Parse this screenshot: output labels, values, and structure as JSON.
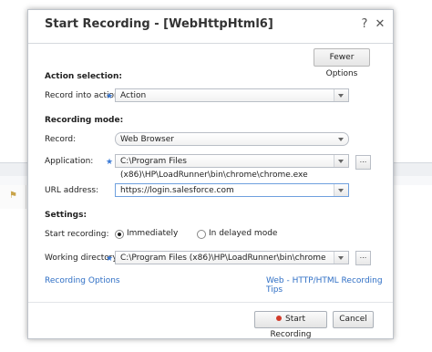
{
  "dialog": {
    "title": "Start Recording - [WebHttpHtml6]",
    "help": "?",
    "close": "✕",
    "fewer_options": "Fewer Options"
  },
  "action_selection": {
    "heading": "Action selection:",
    "record_into_label": "Record into action:",
    "record_into_value": "Action"
  },
  "recording_mode": {
    "heading": "Recording mode:",
    "record_label": "Record:",
    "record_value": "Web Browser",
    "application_label": "Application:",
    "application_value": "C:\\Program Files (x86)\\HP\\LoadRunner\\bin\\chrome\\chrome.exe",
    "url_label": "URL address:",
    "url_value": "https://login.salesforce.com"
  },
  "settings": {
    "heading": "Settings:",
    "start_label": "Start recording:",
    "option_immediately": "Immediately",
    "option_delayed": "In delayed mode",
    "working_dir_label": "Working directory:",
    "working_dir_value": "C:\\Program Files (x86)\\HP\\LoadRunner\\bin\\chrome"
  },
  "links": {
    "recording_options": "Recording Options",
    "tips": "Web - HTTP/HTML Recording Tips"
  },
  "buttons": {
    "start": "Start Recording",
    "cancel": "Cancel",
    "browse": "..."
  },
  "colors": {
    "accent": "#3b7ad6",
    "link": "#2f6fc5",
    "record": "#d23a2a"
  }
}
